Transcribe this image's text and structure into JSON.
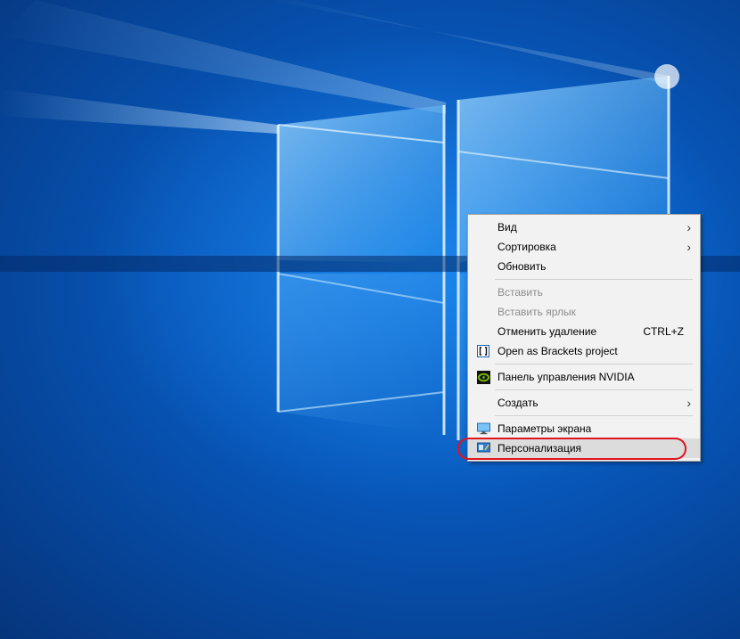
{
  "context_menu": {
    "items": [
      {
        "label": "Вид",
        "icon": "",
        "shortcut": "",
        "submenu": true,
        "disabled": false
      },
      {
        "label": "Сортировка",
        "icon": "",
        "shortcut": "",
        "submenu": true,
        "disabled": false
      },
      {
        "label": "Обновить",
        "icon": "",
        "shortcut": "",
        "submenu": false,
        "disabled": false
      },
      {
        "label": "Вставить",
        "icon": "",
        "shortcut": "",
        "submenu": false,
        "disabled": true
      },
      {
        "label": "Вставить ярлык",
        "icon": "",
        "shortcut": "",
        "submenu": false,
        "disabled": true
      },
      {
        "label": "Отменить удаление",
        "icon": "",
        "shortcut": "CTRL+Z",
        "submenu": false,
        "disabled": false
      },
      {
        "label": "Open as Brackets project",
        "icon": "brackets-icon",
        "shortcut": "",
        "submenu": false,
        "disabled": false
      },
      {
        "label": "Панель управления NVIDIA",
        "icon": "nvidia-icon",
        "shortcut": "",
        "submenu": false,
        "disabled": false
      },
      {
        "label": "Создать",
        "icon": "",
        "shortcut": "",
        "submenu": true,
        "disabled": false
      },
      {
        "label": "Параметры экрана",
        "icon": "display-settings-icon",
        "shortcut": "",
        "submenu": false,
        "disabled": false
      },
      {
        "label": "Персонализация",
        "icon": "personalization-icon",
        "shortcut": "",
        "submenu": false,
        "disabled": false,
        "selected": true
      }
    ]
  },
  "annotation": {
    "highlight_color": "#e0141e",
    "highlighted_item": "Персонализация"
  },
  "colors": {
    "wallpaper_blue": "#0a5fc4",
    "menu_background": "#f2f2f2"
  }
}
